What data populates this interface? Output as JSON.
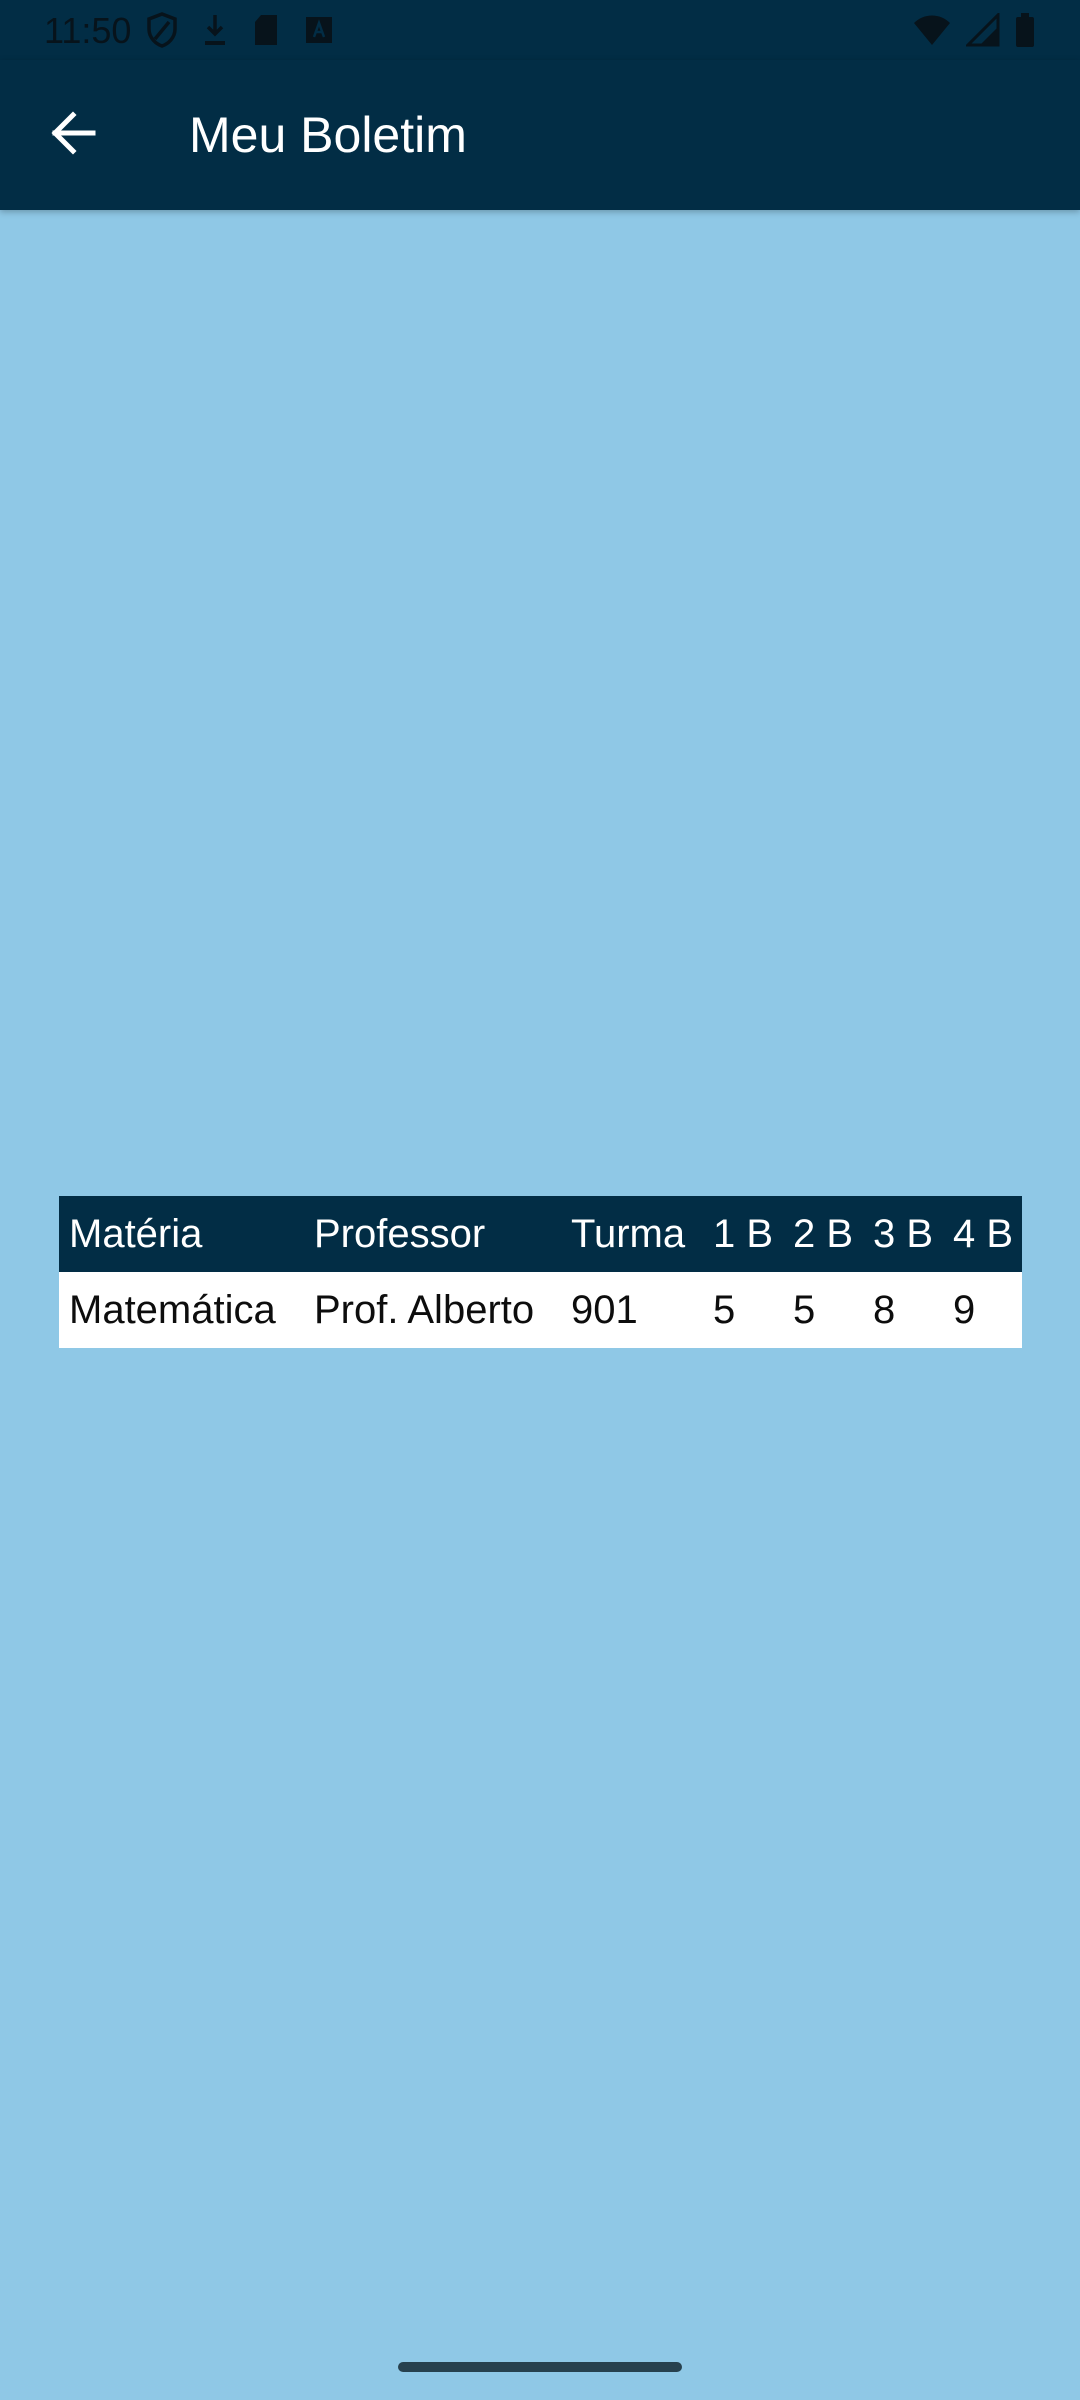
{
  "status_bar": {
    "time": "11:50",
    "left_icons": [
      "shield-icon",
      "download-icon",
      "sd-card-icon",
      "text-a-icon"
    ],
    "right_icons": [
      "wifi-icon",
      "signal-icon",
      "battery-icon"
    ]
  },
  "app_bar": {
    "back_icon": "arrow-left-icon",
    "title": "Meu Boletim"
  },
  "report_table": {
    "headers": [
      "Matéria",
      "Professor",
      "Turma",
      "1 B",
      "2 B",
      "3 B",
      "4 B"
    ],
    "rows": [
      [
        "Matemática",
        "Prof. Alberto",
        "901",
        "5",
        "5",
        "8",
        "9"
      ]
    ]
  },
  "colors": {
    "primary_dark": "#022d45",
    "background": "#8fc8e6",
    "row_background": "#ffffff"
  }
}
